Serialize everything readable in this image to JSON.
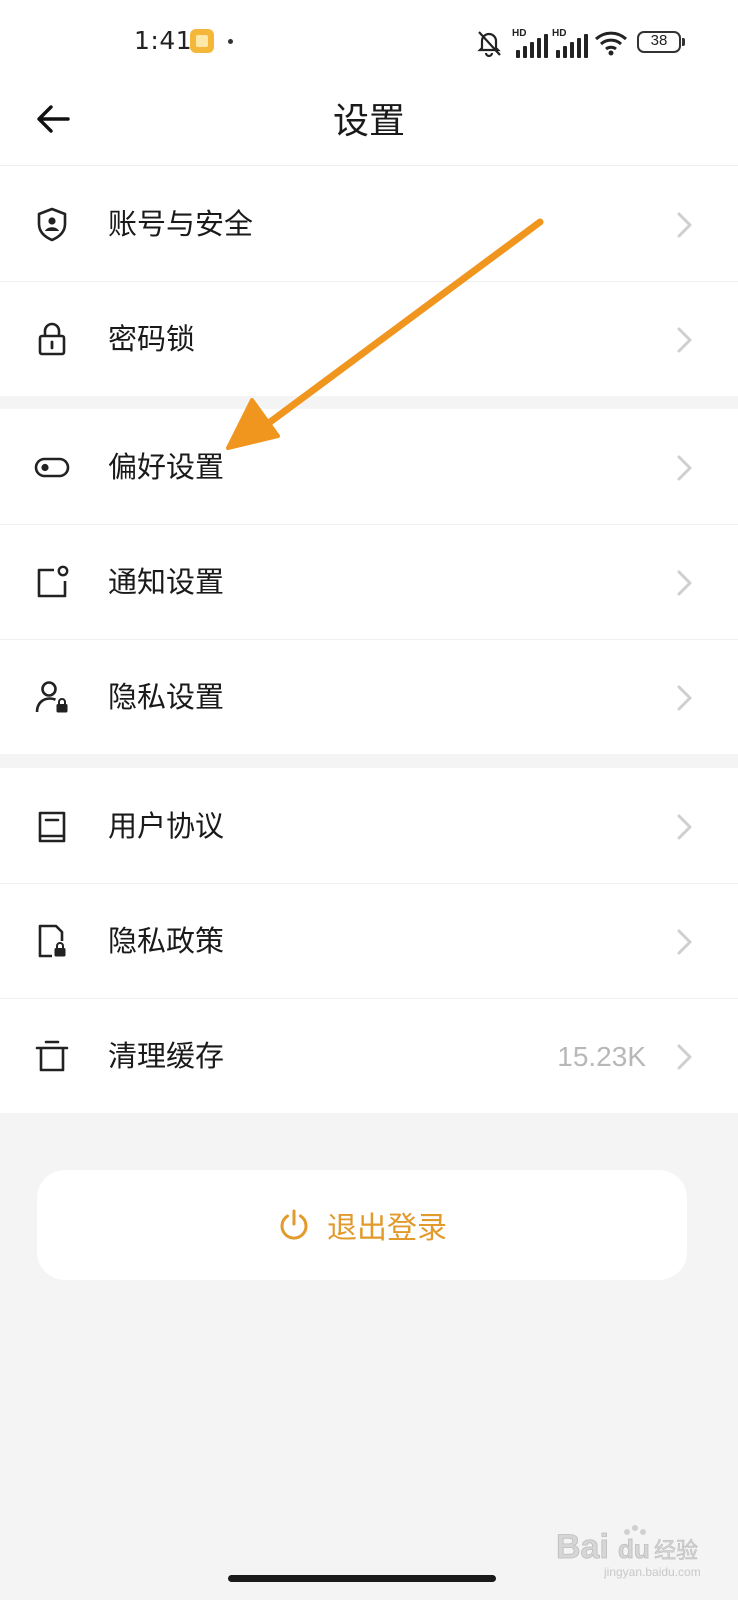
{
  "status_bar": {
    "time": "1:41",
    "battery": "38",
    "hd_label_1": "HD",
    "hd_label_2": "HD"
  },
  "header": {
    "title": "设置"
  },
  "groups": [
    {
      "items": [
        {
          "label": "账号与安全",
          "icon": "shield-icon"
        },
        {
          "label": "密码锁",
          "icon": "lock-icon"
        }
      ]
    },
    {
      "items": [
        {
          "label": "偏好设置",
          "icon": "toggle-icon"
        },
        {
          "label": "通知设置",
          "icon": "notification-icon"
        },
        {
          "label": "隐私设置",
          "icon": "user-lock-icon"
        }
      ]
    },
    {
      "items": [
        {
          "label": "用户协议",
          "icon": "book-icon"
        },
        {
          "label": "隐私政策",
          "icon": "document-lock-icon"
        },
        {
          "label": "清理缓存",
          "icon": "trash-icon",
          "value": "15.23K"
        }
      ]
    }
  ],
  "logout": {
    "label": "退出登录",
    "icon": "power-icon"
  },
  "watermark": {
    "brand": "Bai du 经验",
    "domain": "jingyan.baidu.com"
  },
  "colors": {
    "accent": "#e29a2c",
    "arrow": "#f0961e",
    "background": "#f4f4f4",
    "surface": "#ffffff"
  }
}
